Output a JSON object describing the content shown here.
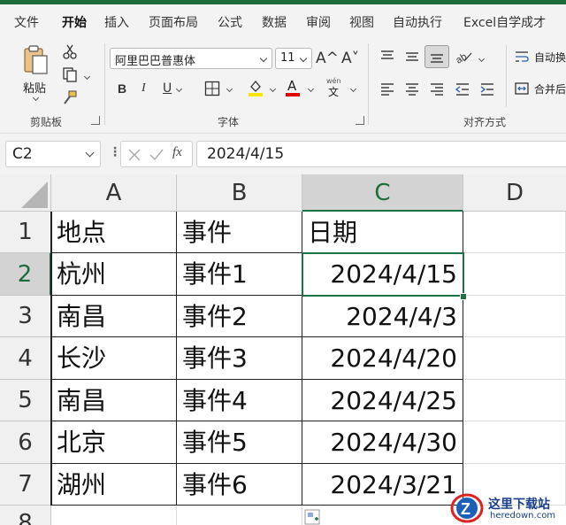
{
  "tabs": [
    "文件",
    "开始",
    "插入",
    "页面布局",
    "公式",
    "数据",
    "审阅",
    "视图",
    "自动执行",
    "Excel自学成才"
  ],
  "active_tab": "开始",
  "ribbon": {
    "clipboard": {
      "paste_label": "粘贴",
      "group_label": "剪贴板"
    },
    "font": {
      "font_name": "阿里巴巴普惠体",
      "font_size": "11",
      "grow": "A^",
      "shrink": "A˅",
      "bold": "B",
      "italic": "I",
      "underline": "U",
      "phonetic": "wén",
      "group_label": "字体"
    },
    "alignment": {
      "wrap_label": "自动换",
      "merge_label": "合并后",
      "group_label": "对齐方式"
    }
  },
  "formula_bar": {
    "name_box": "C2",
    "fx": "fx",
    "value": "2024/4/15"
  },
  "sheet": {
    "columns": [
      "A",
      "B",
      "C",
      "D"
    ],
    "rows": [
      "1",
      "2",
      "3",
      "4",
      "5",
      "6",
      "7",
      "8"
    ],
    "selected_cell": "C2",
    "header": [
      "地点",
      "事件",
      "日期"
    ],
    "data": [
      [
        "杭州",
        "事件1",
        "2024/4/15"
      ],
      [
        "南昌",
        "事件2",
        "2024/4/3"
      ],
      [
        "长沙",
        "事件3",
        "2024/4/20"
      ],
      [
        "南昌",
        "事件4",
        "2024/4/25"
      ],
      [
        "北京",
        "事件5",
        "2024/4/30"
      ],
      [
        "湖州",
        "事件6",
        "2024/3/21"
      ]
    ]
  },
  "watermark": {
    "title": "这里下载站",
    "url": "heredown.com"
  },
  "colors": {
    "accent": "#1e7145",
    "brand": "#1e6b3a"
  }
}
